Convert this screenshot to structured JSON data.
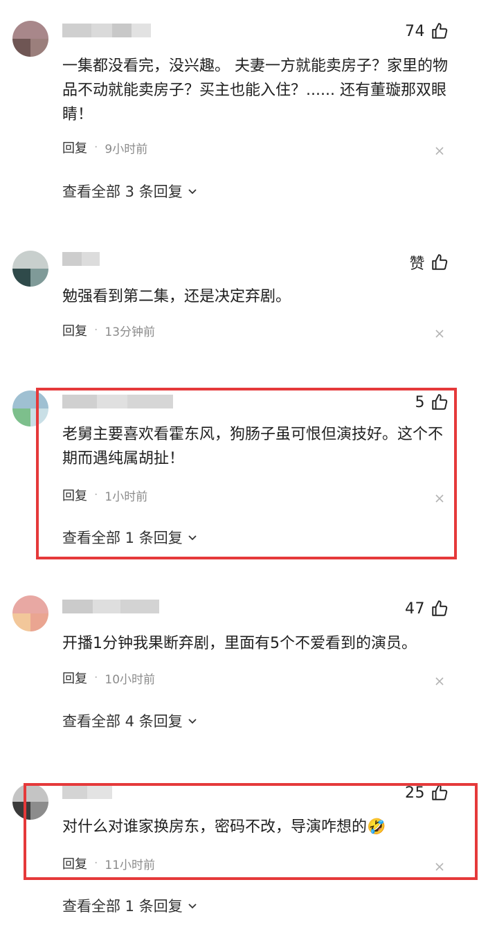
{
  "comments": [
    {
      "likes": "74",
      "text": "一集都没看完，没兴趣。 夫妻一方就能卖房子？家里的物品不动就能卖房子？买主也能入住？...... 还有董璇那双眼睛！",
      "reply_label": "回复",
      "time": "9小时前",
      "view_replies": "查看全部 3 条回复"
    },
    {
      "likes": "赞",
      "text": "勉强看到第二集，还是决定弃剧。",
      "reply_label": "回复",
      "time": "13分钟前"
    },
    {
      "likes": "5",
      "text": "老舅主要喜欢看霍东风，狗肠子虽可恨但演技好。这个不期而遇纯属胡扯！",
      "reply_label": "回复",
      "time": "1小时前",
      "view_replies": "查看全部 1 条回复"
    },
    {
      "likes": "47",
      "text": "开播1分钟我果断弃剧，里面有5个不爱看到的演员。",
      "reply_label": "回复",
      "time": "10小时前",
      "view_replies": "查看全部 4 条回复"
    },
    {
      "likes": "25",
      "text": "对什么对谁家换房东，密码不改，导演咋想的",
      "emoji": "🤣",
      "reply_label": "回复",
      "time": "11小时前",
      "view_replies": "查看全部 1 条回复"
    }
  ],
  "colors": {
    "highlight": "#e5393a",
    "meta_text": "#8b8b8b",
    "body_text": "#1f1f1f"
  },
  "icons": [
    "thumbs-up-icon",
    "close-icon",
    "chevron-down-icon",
    "avatar-blurred"
  ]
}
